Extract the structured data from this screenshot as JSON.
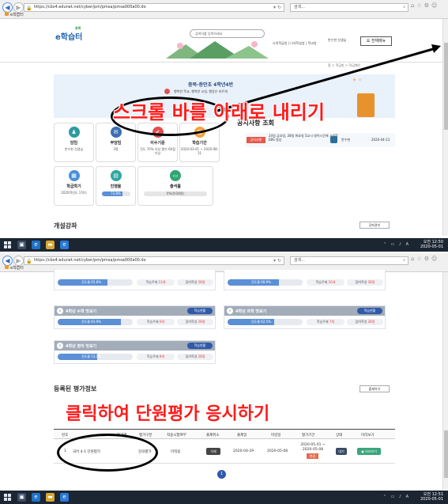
{
  "browser": {
    "url": "https://cbs4.edunet.net/cyber/pm/pmsa/pmsa000a00.do",
    "search_placeholder": "검색...",
    "tab_title": "e학습터",
    "tab_title_2": "e학습터"
  },
  "header": {
    "logo_region": "충북",
    "logo_text": "e학습터",
    "search_placeholder": "검색어를 입력하세요",
    "links": "나의학급방 | 나의학습방 | 학교방",
    "user": "반수현 선생님",
    "menu_button": "전체메뉴"
  },
  "breadcrumb": "홈 > 학급방 > 학급메인",
  "banner": {
    "title": "충북-증안초 4학년4반",
    "subtitle": "행복한 학교, 행복한 교실, 행동은 바르게"
  },
  "cards": [
    {
      "title": "담임",
      "value": "반수현 선생님",
      "icon": "teacher-icon",
      "color": "#2e9aa0"
    },
    {
      "title": "부담임",
      "value": "3명",
      "icon": "mail-icon",
      "color": "#3a6fb3"
    },
    {
      "title": "이수기준",
      "value": "진도 70% 이상 평가 60점 이상",
      "icon": "check-icon",
      "color": "#e24d4d"
    },
    {
      "title": "학습기간",
      "value": "2020-03-01 ~ 2020-08-31",
      "icon": "calendar-icon",
      "color": "#f3a33b"
    },
    {
      "title": "학급학기",
      "value": "2020학년도 1학기",
      "icon": "calendar-icon",
      "color": "#4a90d9"
    },
    {
      "title": "진행율",
      "value": "73.8%",
      "progress": 73.8,
      "icon": "chart-icon",
      "color": "#2ea6a0"
    },
    {
      "title": "출석률",
      "value": "0%(0/28명)",
      "progress": 0,
      "icon": "attendance-icon",
      "color": "#2ea672"
    }
  ],
  "notice": {
    "heading": "공지사항 조회",
    "tag": "공지사항",
    "text": "24일 금요일, 28일 화요일 5교시 영어시간에 시청할 EBS 영상",
    "author": "반수현",
    "date": "2020-04-23"
  },
  "course_section": {
    "title": "개설강좌",
    "manage_button": "강좌관리"
  },
  "taskbar1": {
    "time": "오전 12:50",
    "date": "2020-05-01"
  },
  "taskbar2": {
    "time": "오전 12:51",
    "date": "2020-05-01"
  },
  "annotations": {
    "scroll_instruction": "스크롤 바를 아래로 내리기",
    "click_instruction": "클릭하여 단원평가 응시하기"
  },
  "subjects_top": [
    {
      "progress_label": "진도율 65.8%",
      "progress": 65.8,
      "units_label": "학습주제",
      "units": "13개",
      "students_label": "참여학생",
      "students": "28명"
    },
    {
      "progress_label": "진도율 68.9%",
      "progress": 68.9,
      "units_label": "학습주제",
      "units": "16개",
      "students_label": "참여학생",
      "students": "28명"
    }
  ],
  "subjects": [
    {
      "name": "4학년 수학 맛보기",
      "button": "학습현황",
      "progress_label": "진도율 83.9%",
      "progress": 83.9,
      "units_label": "학습주제",
      "units": "6개",
      "students_label": "참여학생",
      "students": "28명"
    },
    {
      "name": "4학년 과학 맛보기",
      "button": "학습현황",
      "progress_label": "진도율 62.5%",
      "progress": 62.5,
      "units_label": "학습주제",
      "units": "7개",
      "students_label": "참여학생",
      "students": "28명"
    },
    {
      "name": "4학년 영어 맛보기",
      "button": "학습현황",
      "progress_label": "진도율 53.1%",
      "progress": 53.1,
      "units_label": "학습주제",
      "units": "8개",
      "students_label": "참여학생",
      "students": "28명"
    }
  ],
  "eval_section": {
    "title": "등록된 평가정보",
    "register_button": "출제하기",
    "columns": [
      "번호",
      "평가명",
      "평가구분",
      "적용시험여부",
      "출제취소",
      "출제일",
      "마감일",
      "평가기간",
      "상태",
      "미리보기"
    ],
    "row": {
      "no": "1",
      "name": "국어 4-1 단원평가",
      "type": "강의평가",
      "applied": "미적용",
      "delete_button": "삭제",
      "issued": "2020-04-29",
      "deadline": "2020-05-08",
      "period": "2020-05-01 ~ 2020-05-08",
      "change_button": "변경",
      "status": "대기",
      "preview_button": "미리보기"
    },
    "page": "1"
  }
}
